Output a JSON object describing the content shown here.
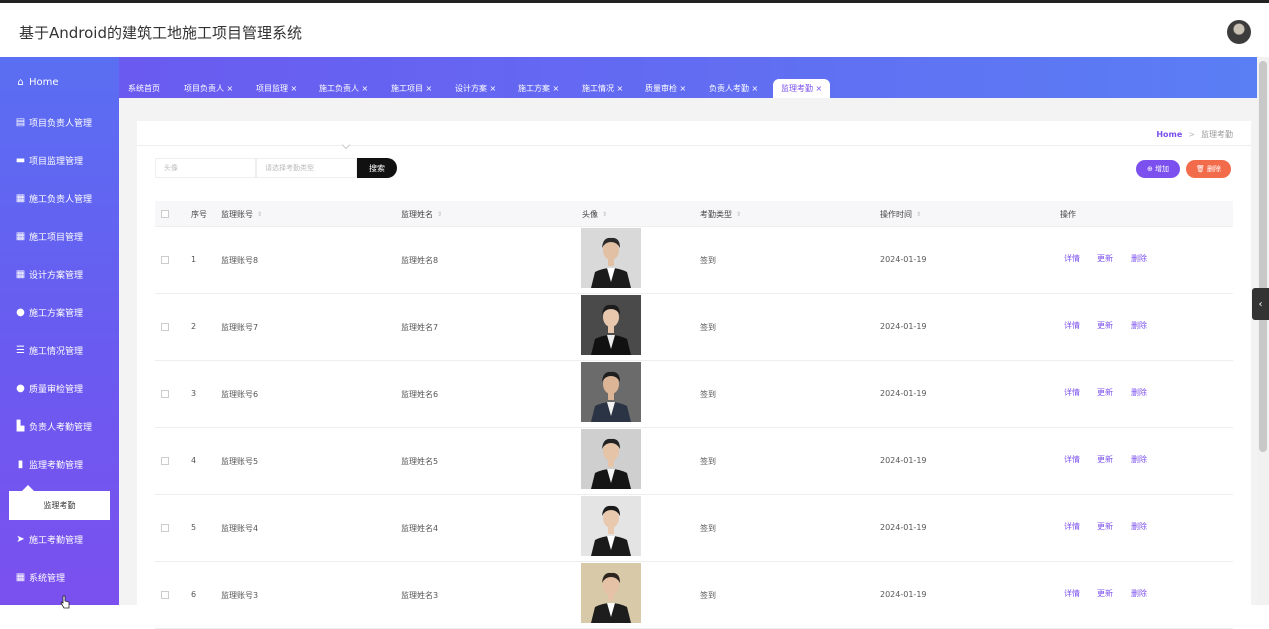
{
  "app": {
    "title": "基于Android的建筑工地施工项目管理系统"
  },
  "sidebar": {
    "items": [
      {
        "label": "Home",
        "icon": "home-icon"
      },
      {
        "label": "项目负责人管理",
        "icon": "clipboard-icon"
      },
      {
        "label": "项目监理管理",
        "icon": "briefcase-icon"
      },
      {
        "label": "施工负责人管理",
        "icon": "grid-icon"
      },
      {
        "label": "施工项目管理",
        "icon": "grid-icon"
      },
      {
        "label": "设计方案管理",
        "icon": "grid-icon"
      },
      {
        "label": "施工方案管理",
        "icon": "user-icon"
      },
      {
        "label": "施工情况管理",
        "icon": "list-icon"
      },
      {
        "label": "质量审检管理",
        "icon": "bulb-icon"
      },
      {
        "label": "负责人考勤管理",
        "icon": "building-icon"
      },
      {
        "label": "监理考勤管理",
        "icon": "bar-chart-icon"
      },
      {
        "label": "施工考勤管理",
        "icon": "paper-plane-icon"
      },
      {
        "label": "系统管理",
        "icon": "grid-icon"
      }
    ],
    "submenu": {
      "label": "监理考勤"
    }
  },
  "tabs": [
    {
      "label": "系统首页"
    },
    {
      "label": "项目负责人 ×"
    },
    {
      "label": "项目监理 ×"
    },
    {
      "label": "施工负责人 ×"
    },
    {
      "label": "施工项目 ×"
    },
    {
      "label": "设计方案 ×"
    },
    {
      "label": "施工方案 ×"
    },
    {
      "label": "施工情况 ×"
    },
    {
      "label": "质量审检 ×"
    },
    {
      "label": "负责人考勤 ×"
    },
    {
      "label": "监理考勤 ×"
    }
  ],
  "breadcrumb": {
    "home": "Home",
    "sep": ">",
    "current": "监理考勤"
  },
  "search": {
    "avatar_placeholder": "头像",
    "type_placeholder": "请选择考勤类型",
    "button": "搜索"
  },
  "toolbar": {
    "add": "⊕ 增加",
    "delete": "🗑 删除"
  },
  "table": {
    "columns": [
      "序号",
      "监理账号",
      "监理姓名",
      "头像",
      "考勤类型",
      "操作时间",
      "操作"
    ],
    "sort_icon": "⇕",
    "rows": [
      {
        "no": "1",
        "account": "监理账号8",
        "name": "监理姓名8",
        "type": "签到",
        "time": "2024-01-19"
      },
      {
        "no": "2",
        "account": "监理账号7",
        "name": "监理姓名7",
        "type": "签到",
        "time": "2024-01-19"
      },
      {
        "no": "3",
        "account": "监理账号6",
        "name": "监理姓名6",
        "type": "签到",
        "time": "2024-01-19"
      },
      {
        "no": "4",
        "account": "监理账号5",
        "name": "监理姓名5",
        "type": "签到",
        "time": "2024-01-19"
      },
      {
        "no": "5",
        "account": "监理账号4",
        "name": "监理姓名4",
        "type": "签到",
        "time": "2024-01-19"
      },
      {
        "no": "6",
        "account": "监理账号3",
        "name": "监理姓名3",
        "type": "签到",
        "time": "2024-01-19"
      }
    ],
    "actions": {
      "detail": "详情",
      "update": "更新",
      "delete": "删除"
    }
  },
  "colors": {
    "accent": "#7b50ee",
    "danger": "#f26b4a"
  }
}
